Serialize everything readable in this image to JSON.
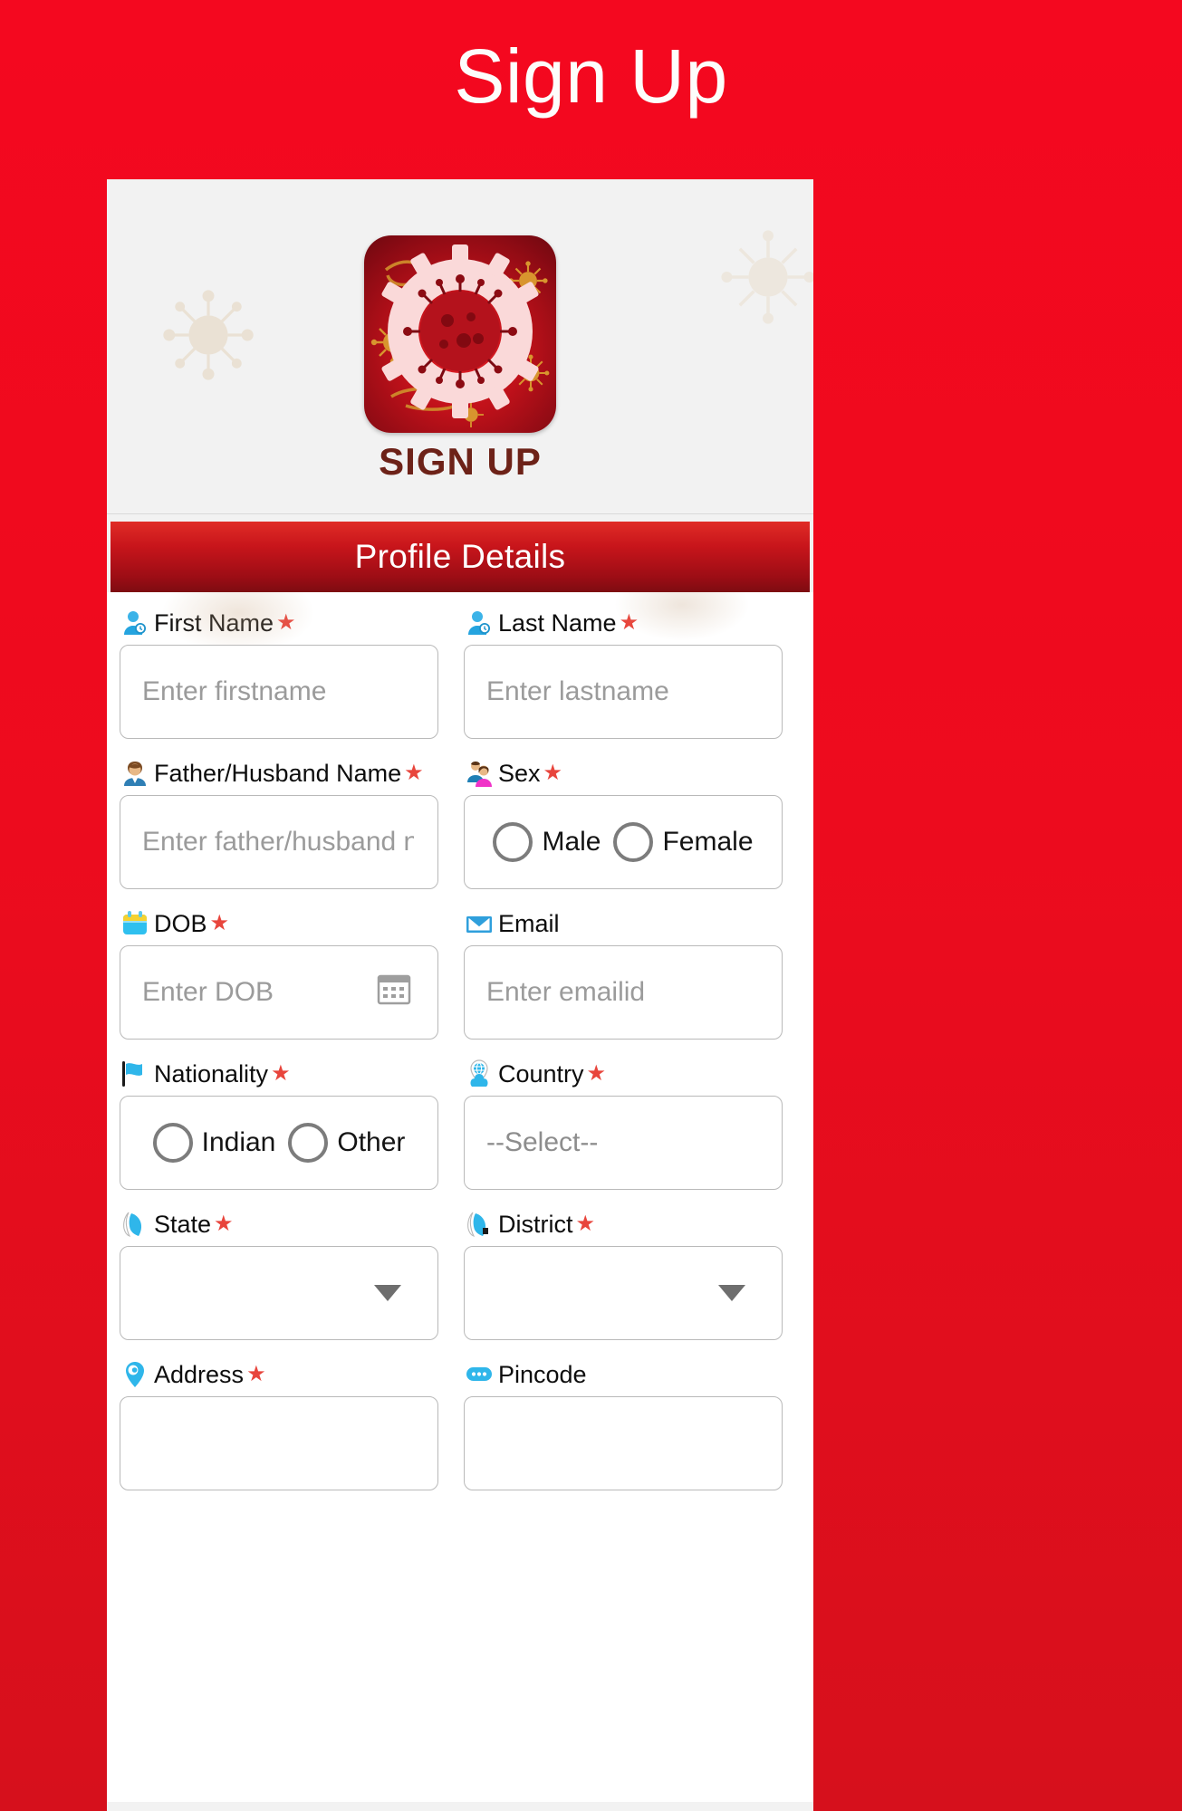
{
  "page": {
    "title": "Sign Up",
    "background_color": "#f20a1e"
  },
  "header_card": {
    "app_logo_name": "corona-app-logo",
    "heading": "SIGN UP",
    "heading_color": "#6d2218"
  },
  "section": {
    "banner_label": "Profile Details",
    "banner_color": "#9d0d15"
  },
  "form": {
    "fields": [
      {
        "key": "first_name",
        "label": "First Name",
        "required": true,
        "icon": "user-icon",
        "type": "text",
        "placeholder": "Enter firstname",
        "value": ""
      },
      {
        "key": "last_name",
        "label": "Last Name",
        "required": true,
        "icon": "user-icon",
        "type": "text",
        "placeholder": "Enter lastname",
        "value": ""
      },
      {
        "key": "father_husband_name",
        "label": "Father/Husband Name",
        "required": true,
        "icon": "person-avatar-icon",
        "type": "text",
        "placeholder": "Enter father/husband name",
        "value": ""
      },
      {
        "key": "sex",
        "label": "Sex",
        "required": true,
        "icon": "couple-icon",
        "type": "radio",
        "options": [
          "Male",
          "Female"
        ],
        "selected": ""
      },
      {
        "key": "dob",
        "label": "DOB",
        "required": true,
        "icon": "calendar-icon",
        "type": "date",
        "placeholder": "Enter DOB",
        "value": "",
        "trailing_icon": "calendar-picker-icon"
      },
      {
        "key": "email",
        "label": "Email",
        "required": false,
        "icon": "envelope-icon",
        "type": "email",
        "placeholder": "Enter emailid",
        "value": ""
      },
      {
        "key": "nationality",
        "label": "Nationality",
        "required": true,
        "icon": "flag-icon",
        "type": "radio",
        "options": [
          "Indian",
          "Other"
        ],
        "selected": ""
      },
      {
        "key": "country",
        "label": "Country",
        "required": true,
        "icon": "location-pin-globe-icon",
        "type": "select",
        "selected_option": "--Select--",
        "options": [
          "--Select--"
        ]
      },
      {
        "key": "state",
        "label": "State",
        "required": true,
        "icon": "map-region-icon",
        "type": "select",
        "selected_option": "",
        "options": []
      },
      {
        "key": "district",
        "label": "District",
        "required": true,
        "icon": "map-region-icon",
        "type": "select",
        "selected_option": "",
        "options": []
      },
      {
        "key": "address",
        "label": "Address",
        "required": true,
        "icon": "map-pin-icon",
        "type": "text",
        "placeholder": "",
        "value": ""
      },
      {
        "key": "pincode",
        "label": "Pincode",
        "required": false,
        "icon": "chat-dots-icon",
        "type": "text",
        "placeholder": "",
        "value": ""
      }
    ],
    "required_marker": "★"
  }
}
